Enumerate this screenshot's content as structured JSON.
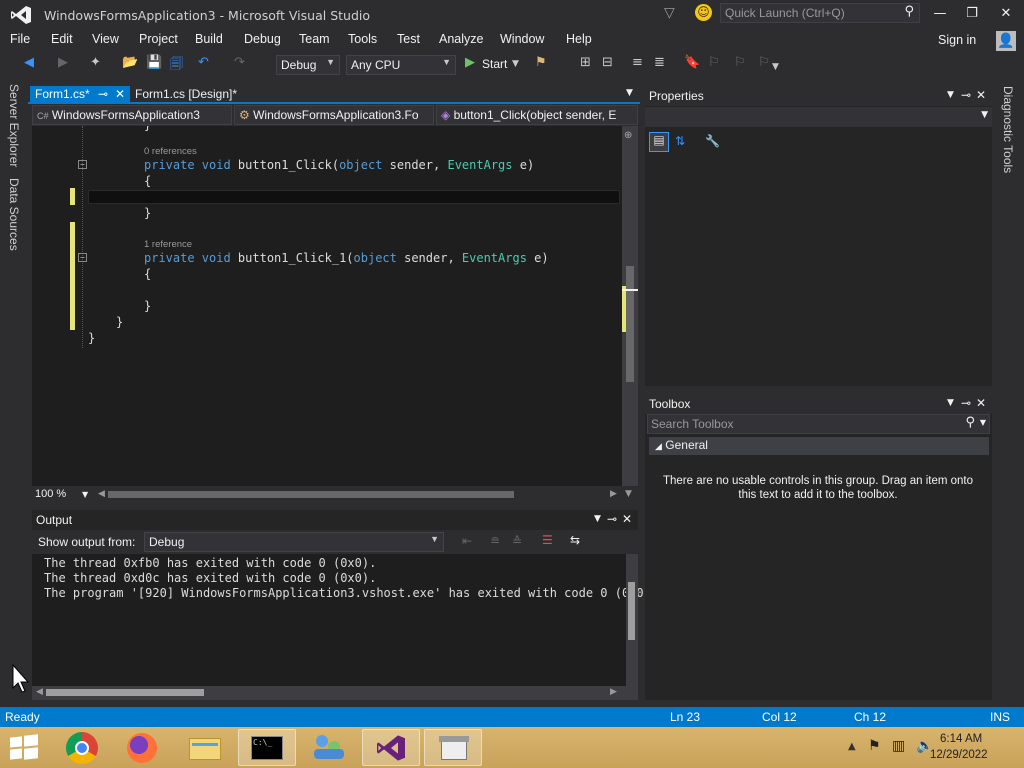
{
  "window": {
    "title": "WindowsFormsApplication3 - Microsoft Visual Studio"
  },
  "quick_launch": {
    "placeholder": "Quick Launch (Ctrl+Q)"
  },
  "menu": [
    "File",
    "Edit",
    "View",
    "Project",
    "Build",
    "Debug",
    "Team",
    "Tools",
    "Test",
    "Analyze",
    "Window",
    "Help"
  ],
  "account": {
    "sign_in": "Sign in"
  },
  "toolbar": {
    "config": "Debug",
    "platform": "Any CPU",
    "start": "Start"
  },
  "sidebar_left": [
    "Server Explorer",
    "Data Sources"
  ],
  "tabs": {
    "active": "Form1.cs*",
    "other": "Form1.cs [Design]*"
  },
  "navbar": {
    "project": "WindowsFormsApplication3",
    "class": "WindowsFormsApplication3.Fo",
    "member": "button1_Click(object sender, E"
  },
  "code": {
    "lens1": "0 references",
    "lens2": "1 reference",
    "method1_kw": "private void ",
    "method1_name": "button1_Click(",
    "method2_name": "button1_Click_1(",
    "arg_kw": "object",
    "arg_sender": " sender, ",
    "arg_type": "EventArgs",
    "arg_e": " e)",
    "open_brace": "{",
    "close_brace": "}"
  },
  "zoom": "100 %",
  "properties": {
    "title": "Properties"
  },
  "toolbox": {
    "title": "Toolbox",
    "search_placeholder": "Search Toolbox",
    "group": "General",
    "empty_message": "There are no usable controls in this group. Drag an item onto this text to add it to the toolbox."
  },
  "diagnostic_tools": "Diagnostic Tools",
  "output": {
    "title": "Output",
    "show_from_label": "Show output from:",
    "source": "Debug",
    "lines": [
      "The thread 0xfb0 has exited with code 0 (0x0).",
      "The thread 0xd0c has exited with code 0 (0x0).",
      "The program '[920] WindowsFormsApplication3.vshost.exe' has exited with code 0 (0x0"
    ]
  },
  "status": {
    "ready": "Ready",
    "line": "Ln 23",
    "col": "Col 12",
    "ch": "Ch 12",
    "mode": "INS"
  },
  "clock": {
    "time": "6:14 AM",
    "date": "12/29/2022"
  },
  "colors": {
    "accent": "#007acc",
    "editor_bg": "#1e1e1e",
    "change_marker": "#e5e57a",
    "taskbar": "#c9a25a"
  }
}
